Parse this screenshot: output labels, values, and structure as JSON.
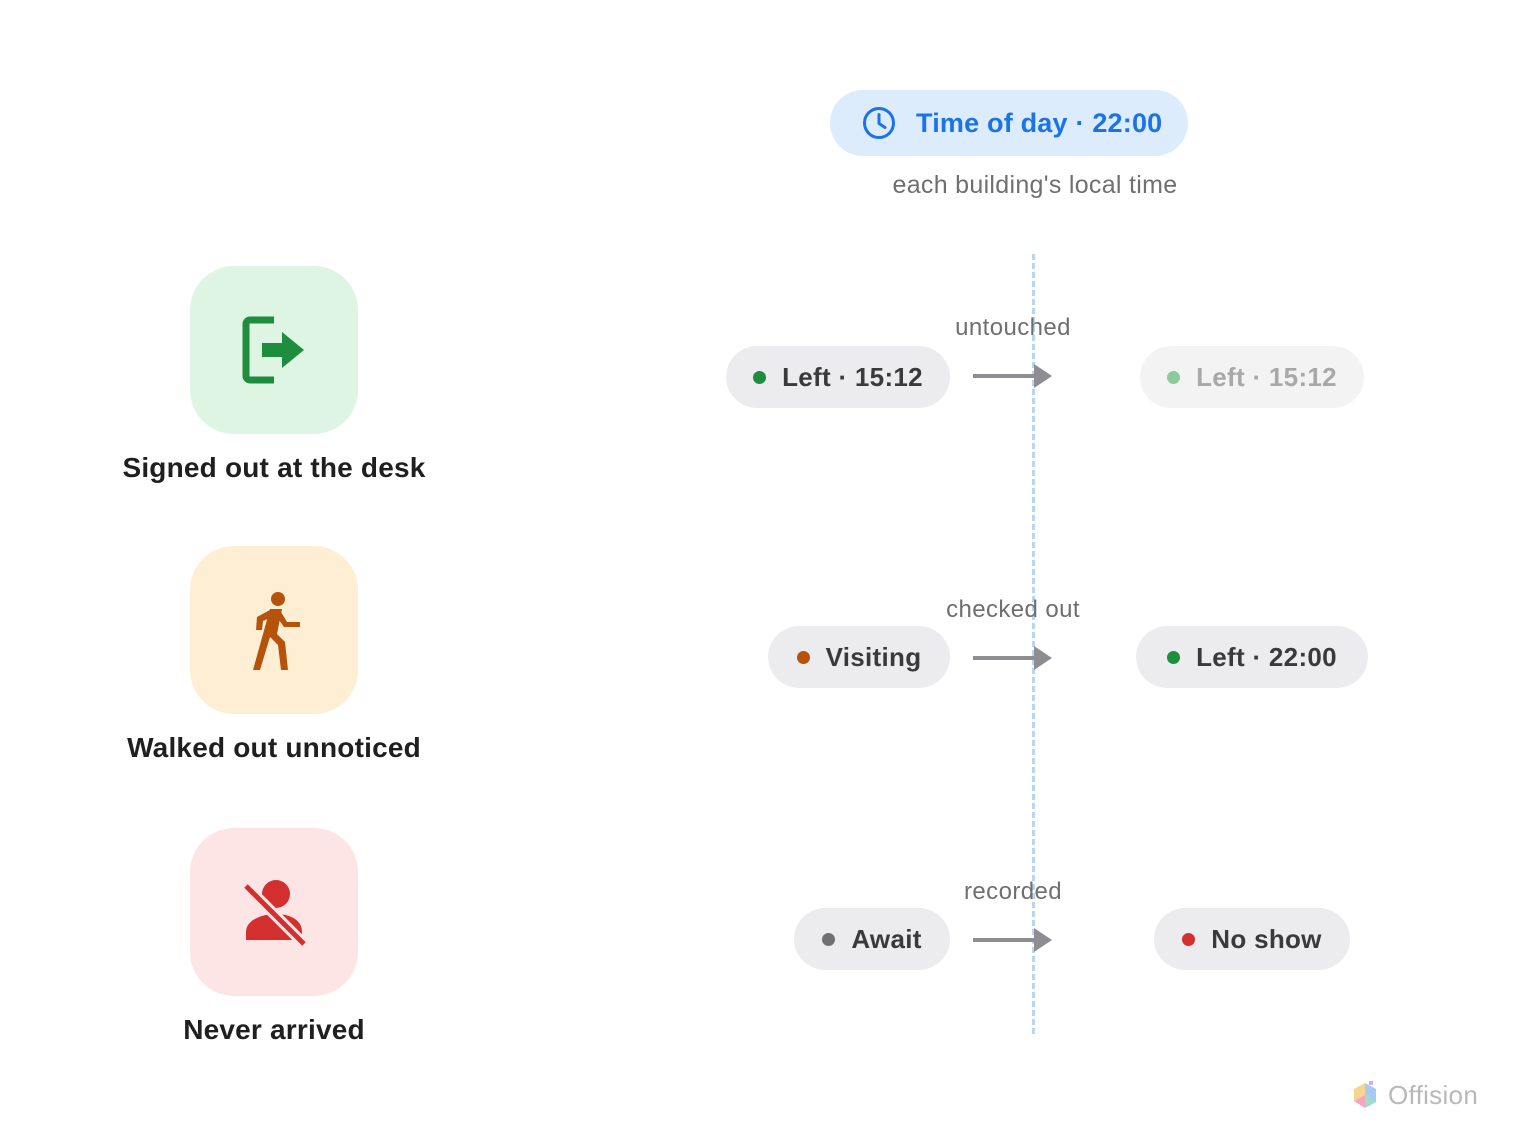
{
  "header": {
    "time_label": "Time of day · 22:00",
    "subtitle": "each building's local time",
    "icon": "clock-icon",
    "accent_color": "#1a73e8"
  },
  "scenarios": [
    {
      "label": "Signed out at the desk",
      "icon": "sign-out-icon",
      "tile_color": "#dff5e4",
      "icon_color": "#1e8e3e",
      "from": {
        "label": "Left · 15:12",
        "dot_color": "#1e8e3e"
      },
      "transition": "untouched",
      "to": {
        "label": "Left · 15:12",
        "dot_color": "#8ccb9b",
        "faded": true
      }
    },
    {
      "label": "Walked out unnoticed",
      "icon": "walking-person-icon",
      "tile_color": "#feeed3",
      "icon_color": "#b5530b",
      "from": {
        "label": "Visiting",
        "dot_color": "#b5530b"
      },
      "transition": "checked out",
      "to": {
        "label": "Left · 22:00",
        "dot_color": "#1e8e3e"
      }
    },
    {
      "label": "Never arrived",
      "icon": "person-off-icon",
      "tile_color": "#fde5e5",
      "icon_color": "#d32f2f",
      "from": {
        "label": "Await",
        "dot_color": "#707070"
      },
      "transition": "recorded",
      "to": {
        "label": "No show",
        "dot_color": "#d32f2f"
      }
    }
  ],
  "brand": {
    "name": "Offision",
    "icon": "offision-logo-icon"
  }
}
